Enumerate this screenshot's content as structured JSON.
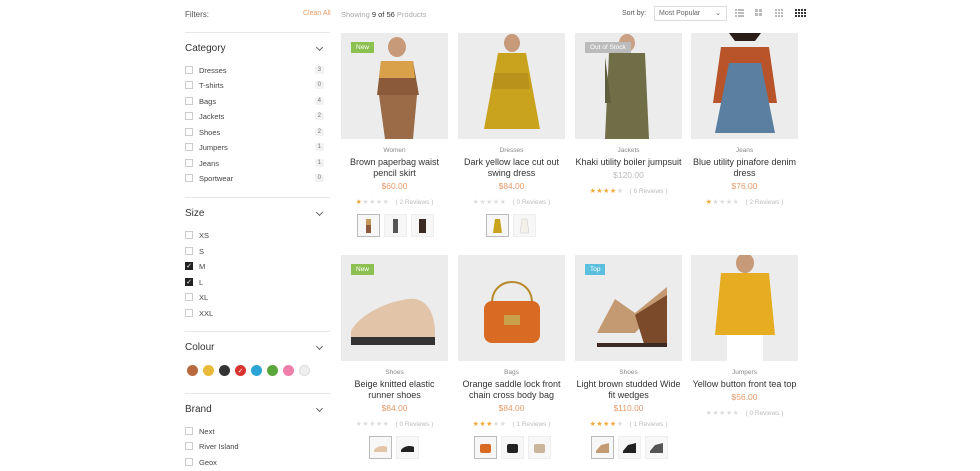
{
  "toolbar": {
    "filters_label": "Filters:",
    "clean_all": "Clean All",
    "showing_prefix": "Showing",
    "showing_count": "9 of 56",
    "showing_suffix": "Products",
    "sort_label": "Sort by:",
    "sort_value": "Most Popular"
  },
  "sidebar": {
    "category": {
      "title": "Category",
      "items": [
        {
          "label": "Dresses",
          "count": "3"
        },
        {
          "label": "T-shirts",
          "count": "0"
        },
        {
          "label": "Bags",
          "count": "4"
        },
        {
          "label": "Jackets",
          "count": "2"
        },
        {
          "label": "Shoes",
          "count": "2"
        },
        {
          "label": "Jumpers",
          "count": "1"
        },
        {
          "label": "Jeans",
          "count": "1"
        },
        {
          "label": "Sportwear",
          "count": "0"
        }
      ]
    },
    "size": {
      "title": "Size",
      "items": [
        {
          "label": "XS",
          "checked": false
        },
        {
          "label": "S",
          "checked": false
        },
        {
          "label": "M",
          "checked": true
        },
        {
          "label": "L",
          "checked": true
        },
        {
          "label": "XL",
          "checked": false
        },
        {
          "label": "XXL",
          "checked": false
        }
      ]
    },
    "colour": {
      "title": "Colour",
      "swatches": [
        "#b86a3f",
        "#e9b93a",
        "#333333",
        "#d9332e",
        "#2aa5d6",
        "#5aa63a",
        "#ef7faa",
        "#eeeeee"
      ],
      "selected_index": 3
    },
    "brand": {
      "title": "Brand",
      "items": [
        {
          "label": "Next"
        },
        {
          "label": "River Island"
        },
        {
          "label": "Geox"
        }
      ]
    }
  },
  "products": [
    {
      "badge": "New",
      "badge_color": "#8cc152",
      "category": "Women",
      "name": "Brown paperbag waist pencil skirt",
      "price": "$60.00",
      "stars": 1,
      "reviews": "( 2 Reviews )"
    },
    {
      "badge": "",
      "category": "Dresses",
      "name": "Dark yellow lace cut out swing dress",
      "price": "$84.00",
      "stars": 0,
      "reviews": "( 0 Reviews )"
    },
    {
      "badge": "Out of Stock",
      "badge_color": "#bbbbbb",
      "category": "Jackets",
      "name": "Khaki utility boiler jumpsuit",
      "price": "$120.00",
      "stars": 4,
      "reviews": "( 6 Reviews )"
    },
    {
      "badge": "",
      "category": "Jeans",
      "name": "Blue utility pinafore denim dress",
      "price": "$76.00",
      "stars": 1,
      "reviews": "( 2 Reviews )"
    },
    {
      "badge": "New",
      "badge_color": "#8cc152",
      "category": "Shoes",
      "name": "Beige knitted elastic runner shoes",
      "price": "$84.00",
      "stars": 0,
      "reviews": "( 0 Reviews )"
    },
    {
      "badge": "",
      "category": "Bags",
      "name": "Orange saddle lock front chain cross body bag",
      "price": "$84.00",
      "stars": 3,
      "reviews": "( 1 Reviews )"
    },
    {
      "badge": "Top",
      "badge_color": "#5bc0de",
      "category": "Shoes",
      "name": "Light brown studded Wide fit wedges",
      "price": "$110.00",
      "stars": 4,
      "reviews": "( 1 Reviews )"
    },
    {
      "badge": "",
      "category": "Jumpers",
      "name": "Yellow button front tea top",
      "price": "$56.00",
      "stars": 0,
      "reviews": "( 0 Reviews )"
    }
  ]
}
